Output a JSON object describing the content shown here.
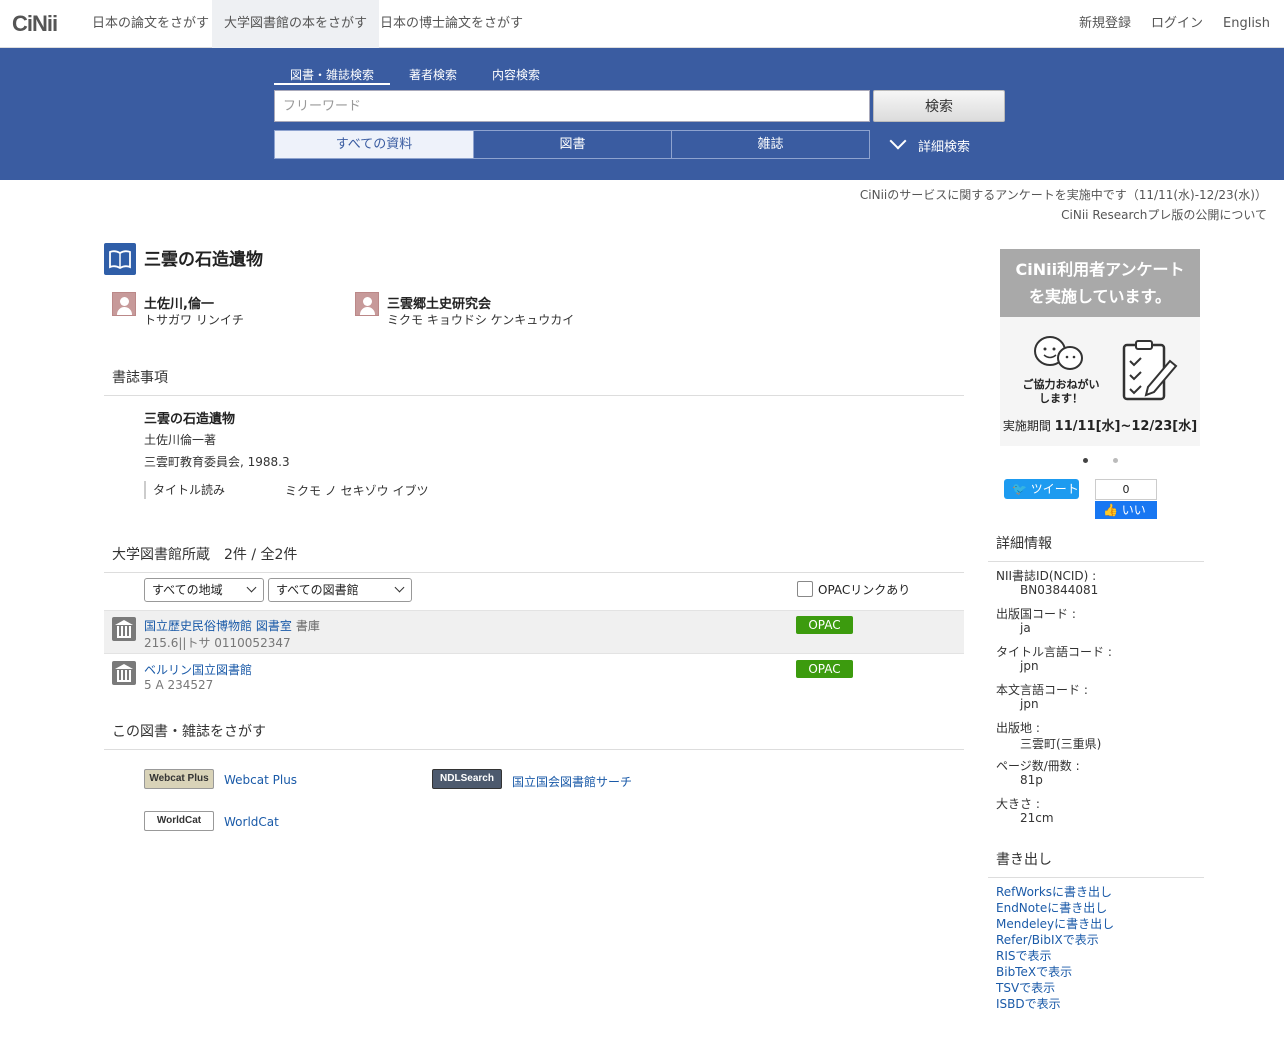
{
  "topnav": {
    "logo": "CiNii",
    "tabs": [
      {
        "label": "日本の論文をさがす"
      },
      {
        "label": "大学図書館の本をさがす"
      },
      {
        "label": "日本の博士論文をさがす"
      }
    ],
    "register": "新規登録",
    "login": "ログイン",
    "english": "English"
  },
  "search": {
    "tabs": [
      "図書・雑誌検索",
      "著者検索",
      "内容検索"
    ],
    "placeholder": "フリーワード",
    "button": "検索",
    "filters": [
      "すべての資料",
      "図書",
      "雑誌"
    ],
    "advanced": "詳細検索"
  },
  "notices": [
    "CiNiiのサービスに関するアンケートを実施中です（11/11(水)-12/23(水)）",
    "CiNii Researchプレ版の公開について"
  ],
  "book": {
    "title": "三雲の石造遺物",
    "authors": [
      {
        "name": "土佐川,倫一",
        "kana": "トサガワ リンイチ"
      },
      {
        "name": "三雲郷土史研究会",
        "kana": "ミクモ キョウドシ ケンキュウカイ"
      }
    ]
  },
  "bibliography": {
    "heading": "書誌事項",
    "title": "三雲の石造遺物",
    "author_line": "土佐川倫一著",
    "publisher_line": "三雲町教育委員会, 1988.3",
    "yomi_label": "タイトル読み",
    "yomi_value": "ミクモ ノ セキゾウ イブツ"
  },
  "holdings": {
    "heading": "大学図書館所蔵　2件 / 全2件",
    "region_select": "すべての地域",
    "library_select": "すべての図書館",
    "opac_check_label": "OPACリンクあり",
    "rows": [
      {
        "library": "国立歴史民俗博物館 図書室",
        "location": "書庫",
        "call": "215.6||トサ  0110052347",
        "opac": "OPAC"
      },
      {
        "library": "ベルリン国立図書館",
        "location": "",
        "call": "5 A 234527",
        "opac": "OPAC"
      }
    ]
  },
  "findthis": {
    "heading": "この図書・雑誌をさがす",
    "links": [
      {
        "logo": "Webcat Plus",
        "label": "Webcat Plus"
      },
      {
        "logo": "NDLSearch",
        "label": "国立国会図書館サーチ"
      },
      {
        "logo": "WorldCat",
        "label": "WorldCat"
      }
    ]
  },
  "banner": {
    "line1": "CiNii利用者アンケート",
    "line2": "を実施しています。",
    "coop": "ご協力おねがい します！",
    "period_label": "実施期間",
    "period_value": "11/11[水]~12/23[水]"
  },
  "social": {
    "tweet": "ツイート",
    "like_count": "0",
    "like": "いいね"
  },
  "details": {
    "heading": "詳細情報",
    "items": [
      {
        "label": "NII書誌ID(NCID) :",
        "value": "BN03844081"
      },
      {
        "label": "出版国コード :",
        "value": "ja"
      },
      {
        "label": "タイトル言語コード :",
        "value": "jpn"
      },
      {
        "label": "本文言語コード :",
        "value": "jpn"
      },
      {
        "label": "出版地 :",
        "value": "三雲町(三重県)"
      },
      {
        "label": "ページ数/冊数 :",
        "value": "81p"
      },
      {
        "label": "大きさ :",
        "value": "21cm"
      }
    ]
  },
  "export": {
    "heading": "書き出し",
    "links": [
      "RefWorksに書き出し",
      "EndNoteに書き出し",
      "Mendeleyに書き出し",
      "Refer/BibIXで表示",
      "RISで表示",
      "BibTeXで表示",
      "TSVで表示",
      "ISBDで表示"
    ]
  },
  "colors": {
    "band": "#3a5ca1",
    "opac": "#3c9b0e",
    "link": "#1a5aa8"
  }
}
